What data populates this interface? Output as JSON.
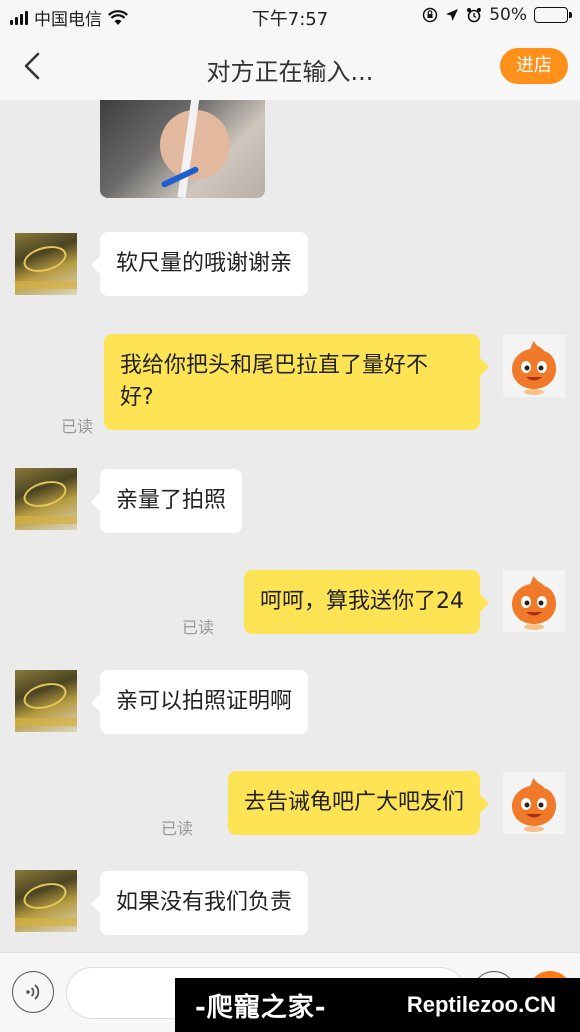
{
  "status_bar": {
    "carrier": "中国电信",
    "time": "下午7:57",
    "battery": "50%",
    "battery_level": 0.5
  },
  "nav": {
    "title": "对方正在输入...",
    "shop_label": "进店"
  },
  "messages": [
    {
      "sender": "other",
      "text": "软尺量的哦谢谢亲"
    },
    {
      "sender": "me",
      "lines": [
        "我给你把头和尾巴拉直了量好不",
        "好?"
      ],
      "status": "已读"
    },
    {
      "sender": "other",
      "text": "亲量了拍照"
    },
    {
      "sender": "me",
      "text": "呵呵，算我送你了24",
      "status": "已读"
    },
    {
      "sender": "other",
      "text": "亲可以拍照证明啊"
    },
    {
      "sender": "me",
      "text": "去告诫龟吧广大吧友们",
      "status": "已读"
    },
    {
      "sender": "other",
      "text": "如果没有我们负责"
    }
  ],
  "watermark": {
    "cn": "-爬寵之家-",
    "en": "Reptilezoo.CN"
  },
  "colors": {
    "accent": "#ff9019",
    "my_bubble": "#fee455",
    "other_bubble": "#ffffff",
    "background": "#ebebeb"
  },
  "icons": {
    "back": "chevron-left-icon",
    "voice": "voice-icon",
    "emoji": "emoji-icon",
    "plus": "plus-icon"
  }
}
